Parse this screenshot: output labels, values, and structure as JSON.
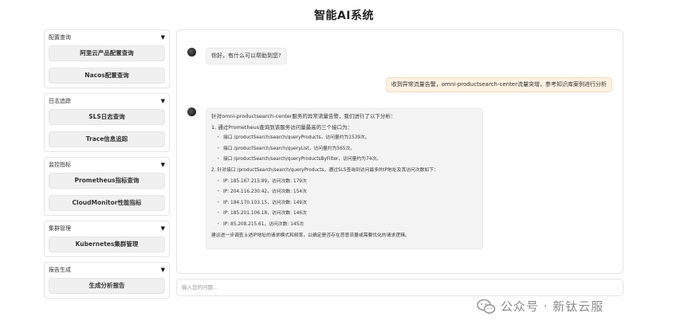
{
  "app": {
    "title": "智能AI系统"
  },
  "sidebar": {
    "groups": [
      {
        "label": "配置查询",
        "buttons": [
          "阿里云产品配置查询",
          "Nacos配置查询"
        ]
      },
      {
        "label": "日志追踪",
        "buttons": [
          "SLS日志查询",
          "Trace信息追踪"
        ]
      },
      {
        "label": "监控指标",
        "buttons": [
          "Prometheus指标查询",
          "CloudMonitor性能指标"
        ]
      },
      {
        "label": "集群管理",
        "buttons": [
          "Kubernetes集群管理"
        ]
      },
      {
        "label": "报告生成",
        "buttons": [
          "生成分析报告"
        ]
      }
    ]
  },
  "chat": {
    "greeting": "你好，有什么可以帮助到您?",
    "user_message": "收到异常流量告警，omni-productsearch-center流量突增，参考知识库案例进行分析",
    "answer": {
      "intro": "针对omni-productsearch-center服务的异常流量告警，我们进行了以下分析：",
      "step1": "1. 通过Prometheus查询到该服务访问量最高的三个接口为：",
      "endpoints": [
        "接口 /productSearch/search/queryProducts，访问量约为1539次。",
        "接口 /productSearch/search/queryList，访问量约为565次。",
        "接口 /productSearch/search/queryProductsByFilter，访问量约为74次。"
      ],
      "step2": "2. 针对接口 /productSearch/search/queryProducts，通过SLS查询到访问最多的IP地址及其访问次数如下：",
      "ips": [
        "IP: 185.167.215.89，访问次数: 179次",
        "IP: 204.116.230.42，访问次数: 154次",
        "IP: 184.170.103.15，访问次数: 149次",
        "IP: 185.201.106.18，访问次数: 146次",
        "IP: 85.208.215.61，访问次数: 145次"
      ],
      "conclusion": "建议进一步调查上述IP地址的请求模式和频率，以确定是否存在恶意流量或需要优化的请求逻辑。"
    }
  },
  "input": {
    "placeholder": "输入您的问题..."
  },
  "watermark": {
    "text": "公众号 · 新钛云服"
  },
  "icons": {
    "caret": "▼",
    "wechat": "wechat-icon"
  },
  "colors": {
    "user_bubble_bg": "#fdf1e2",
    "bot_bubble_bg": "#f3f3f3"
  }
}
